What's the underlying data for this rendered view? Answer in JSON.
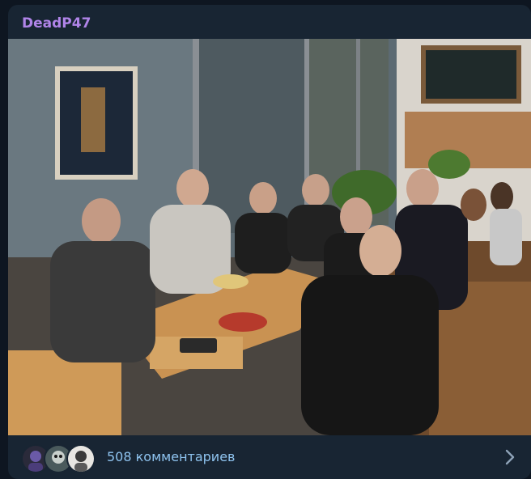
{
  "post": {
    "author": "DeadP47",
    "photo_icon": "group-photo-restaurant",
    "comments": {
      "label": "508 комментариев",
      "avatar_icons": [
        "commenter-avatar-1",
        "commenter-avatar-2",
        "commenter-avatar-3"
      ],
      "open_icon": "chevron-right-icon"
    }
  },
  "colors": {
    "background": "#0e1621",
    "card": "#182533",
    "author": "#b084e8",
    "link": "#8fc4f0"
  }
}
